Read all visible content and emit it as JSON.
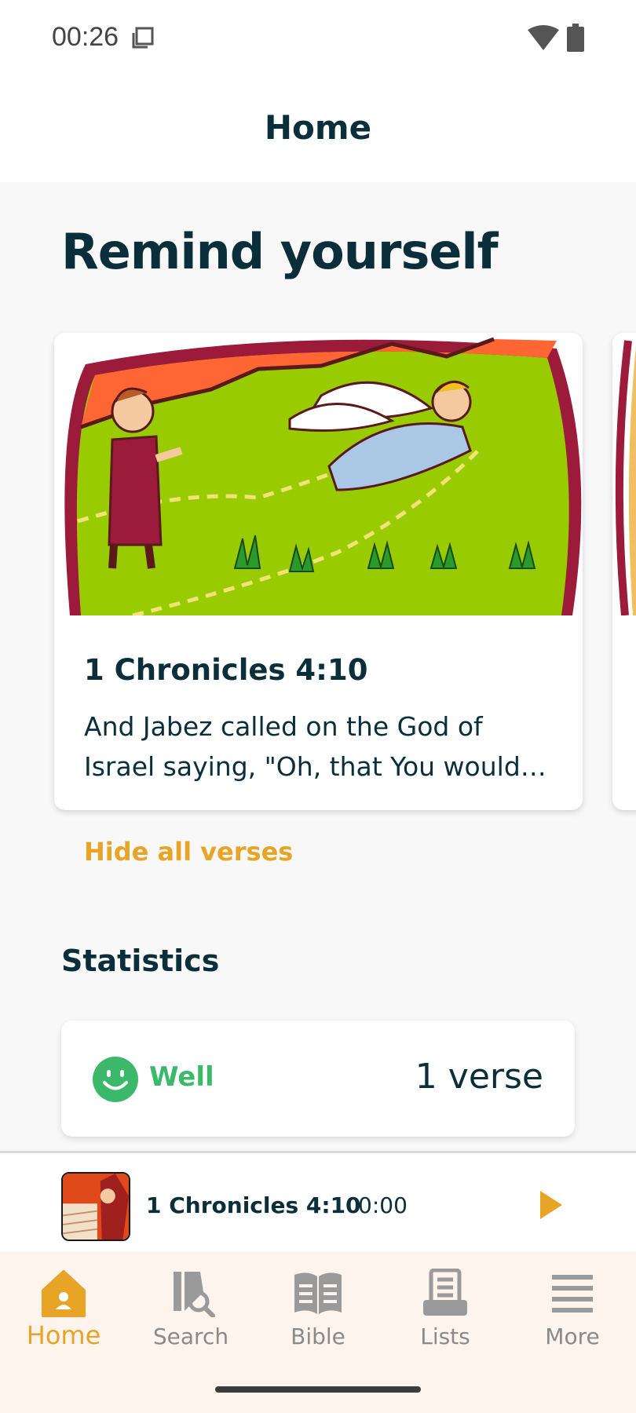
{
  "status_bar": {
    "time": "00:26"
  },
  "app_bar": {
    "title": "Home"
  },
  "remind": {
    "heading": "Remind yourself",
    "cards": [
      {
        "reference": "1 Chronicles 4:10",
        "text": "And Jabez called on the God of Israel saying, \"Oh, that You would bless me indeed, and enlarge my territory\""
      }
    ],
    "hide_label": "Hide all verses"
  },
  "statistics": {
    "heading": "Statistics",
    "status_label": "Well",
    "count": "1",
    "unit": "verse"
  },
  "player": {
    "title": "1 Chronicles 4:10",
    "time": "0:00"
  },
  "nav": {
    "items": [
      {
        "label": "Home",
        "icon": "home-icon",
        "active": true
      },
      {
        "label": "Search",
        "icon": "search-book-icon",
        "active": false
      },
      {
        "label": "Bible",
        "icon": "open-book-icon",
        "active": false
      },
      {
        "label": "Lists",
        "icon": "list-doc-icon",
        "active": false
      },
      {
        "label": "More",
        "icon": "menu-icon",
        "active": false
      }
    ]
  },
  "colors": {
    "primary_text": "#0b2f3a",
    "accent": "#e8a426",
    "success": "#3cb86a",
    "nav_bg": "#fdf4ee"
  }
}
